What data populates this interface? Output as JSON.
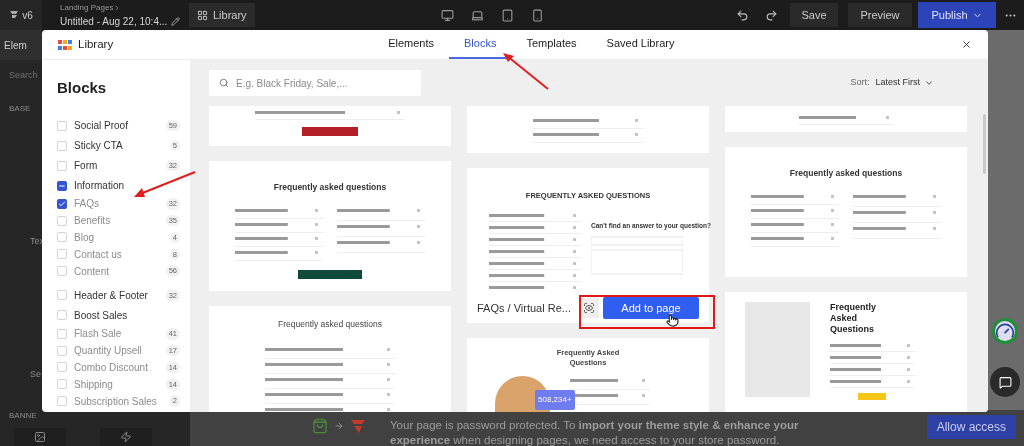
{
  "topbar": {
    "version": "v6",
    "breadcrumb": "Landing Pages",
    "page_title": "Untitled - Aug 22, 10:4...",
    "library_button": "Library",
    "devices": [
      {
        "kind": "desktop"
      },
      {
        "kind": "laptop"
      },
      {
        "kind": "tablet"
      },
      {
        "kind": "phone"
      }
    ],
    "save": "Save",
    "preview": "Preview",
    "publish": "Publish"
  },
  "editor_sidebar": {
    "tab": "Elem",
    "search": "Search",
    "section": "BASE",
    "items": [
      "Tex",
      "Se"
    ],
    "banner_section": "BANNE"
  },
  "library": {
    "title": "Library",
    "tabs": [
      {
        "label": "Elements",
        "selected": false
      },
      {
        "label": "Blocks",
        "selected": true
      },
      {
        "label": "Templates",
        "selected": false
      },
      {
        "label": "Saved Library",
        "selected": false
      }
    ],
    "sidebar": {
      "heading": "Blocks",
      "categories": [
        {
          "label": "Social Proof",
          "count": "59",
          "checked": false
        },
        {
          "label": "Sticky CTA",
          "count": "5",
          "checked": false
        },
        {
          "label": "Form",
          "count": "32",
          "checked": false
        },
        {
          "label": "Information",
          "indeterminate": true,
          "children": [
            {
              "label": "FAQs",
              "count": "32",
              "checked": true
            },
            {
              "label": "Benefits",
              "count": "35",
              "checked": false
            },
            {
              "label": "Blog",
              "count": "4",
              "checked": false
            },
            {
              "label": "Contact us",
              "count": "8",
              "checked": false
            },
            {
              "label": "Content",
              "count": "56",
              "checked": false
            }
          ]
        },
        {
          "label": "Header & Footer",
          "count": "32",
          "checked": false
        },
        {
          "label": "Boost Sales",
          "checked": false,
          "children": [
            {
              "label": "Flash Sale",
              "count": "41",
              "checked": false
            },
            {
              "label": "Quantity Upsell",
              "count": "17",
              "checked": false
            },
            {
              "label": "Combo Discount",
              "count": "14",
              "checked": false
            },
            {
              "label": "Shipping",
              "count": "14",
              "checked": false
            },
            {
              "label": "Subscription Sales",
              "count": "2",
              "checked": false
            }
          ]
        }
      ]
    },
    "search": {
      "placeholder": "E.g. Black Friday, Sale,..."
    },
    "sort": {
      "label": "Sort:",
      "value": "Latest First"
    },
    "columns": [
      {
        "cards": [
          {
            "kind": "cta-fragment",
            "color": "#b3202a"
          },
          {
            "kind": "faq-two-column",
            "heading": "Frequently asked questions",
            "color": "#0f4a3a"
          },
          {
            "kind": "faq-single",
            "heading": "Frequently asked questions"
          }
        ]
      },
      {
        "cards": [
          {
            "kind": "accordion-fragment"
          },
          {
            "kind": "faq-form",
            "heading": "FREQUENTLY ASKED QUESTIONS",
            "subheading": "Can't find an answer to your question?",
            "hover": {
              "name": "FAQs / Virtual Re...",
              "action": "Add to page"
            }
          },
          {
            "kind": "faq-image-left",
            "heading": "Frequently Asked Questions",
            "badge": "508,234+"
          }
        ]
      },
      {
        "cards": [
          {
            "kind": "accordion-fragment-short"
          },
          {
            "kind": "faq-two-column",
            "heading": "Frequently asked questions"
          },
          {
            "kind": "faq-photo-left",
            "heading": "Frequently Asked Questions",
            "color": "#f5c518"
          }
        ]
      }
    ]
  },
  "banner": {
    "text": "Your page is password protected. To **import your theme style & enhance your experience** when designing pages, we need access to your store password.",
    "button": "Allow access"
  }
}
